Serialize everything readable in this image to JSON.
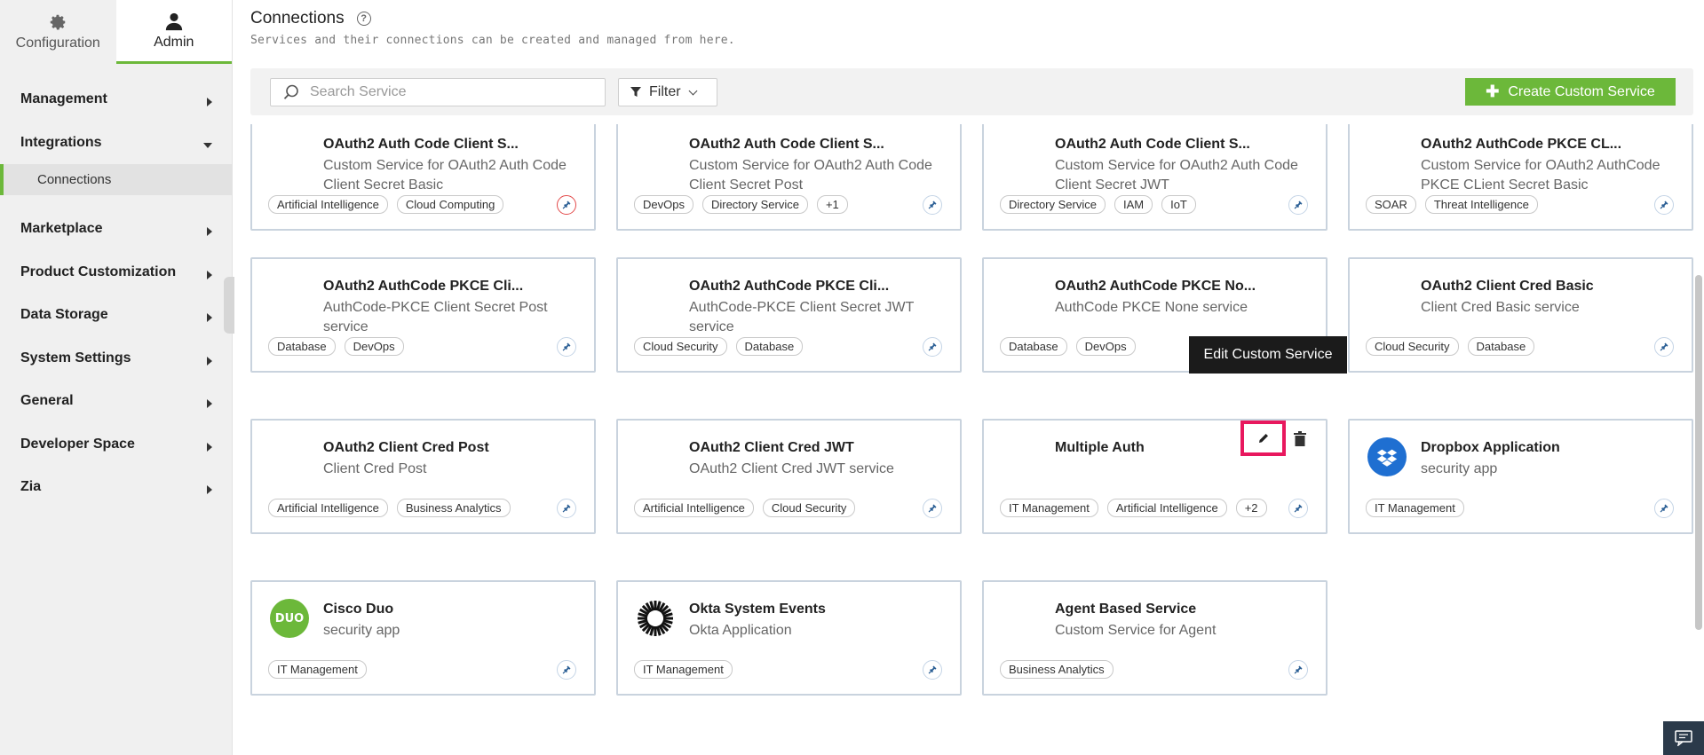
{
  "sidebar": {
    "tabs": [
      {
        "label": "Configuration",
        "icon": "gear-icon"
      },
      {
        "label": "Admin",
        "icon": "user-icon"
      }
    ],
    "items": [
      {
        "label": "Management"
      },
      {
        "label": "Integrations",
        "expanded": true,
        "sub": "Connections"
      },
      {
        "label": "Marketplace"
      },
      {
        "label": "Product Customization"
      },
      {
        "label": "Data Storage"
      },
      {
        "label": "System Settings"
      },
      {
        "label": "General"
      },
      {
        "label": "Developer Space"
      },
      {
        "label": "Zia"
      }
    ]
  },
  "header": {
    "title": "Connections",
    "subtitle": "Services and their connections can be created and managed from here."
  },
  "toolbar": {
    "search_placeholder": "Search Service",
    "filter_label": "Filter",
    "create_label": "Create Custom Service"
  },
  "colors": {
    "accent": "#6cb83a",
    "highlight": "#e8185e",
    "tooltip_bg": "#1b1b1b"
  },
  "cards": [
    {
      "title": "OAuth2 Auth Code Client S...",
      "desc": "Custom Service for OAuth2 Auth Code Client Secret Basic",
      "tags": [
        "Artificial Intelligence",
        "Cloud Computing"
      ],
      "conn_alert": true
    },
    {
      "title": "OAuth2 Auth Code Client S...",
      "desc": "Custom Service for OAuth2 Auth Code Client Secret Post",
      "tags": [
        "DevOps",
        "Directory Service",
        "+1"
      ]
    },
    {
      "title": "OAuth2 Auth Code Client S...",
      "desc": "Custom Service for OAuth2 Auth Code Client Secret JWT",
      "tags": [
        "Directory Service",
        "IAM",
        "IoT"
      ]
    },
    {
      "title": "OAuth2 AuthCode PKCE CL...",
      "desc": "Custom Service for OAuth2 AuthCode PKCE CLient Secret Basic",
      "tags": [
        "SOAR",
        "Threat Intelligence"
      ]
    },
    {
      "title": "OAuth2 AuthCode PKCE Cli...",
      "desc": "AuthCode-PKCE Client Secret Post service",
      "tags": [
        "Database",
        "DevOps"
      ]
    },
    {
      "title": "OAuth2 AuthCode PKCE Cli...",
      "desc": "AuthCode-PKCE Client Secret JWT service",
      "tags": [
        "Cloud Security",
        "Database"
      ]
    },
    {
      "title": "OAuth2 AuthCode PKCE No...",
      "desc": "AuthCode PKCE None service",
      "tags": [
        "Database",
        "DevOps"
      ]
    },
    {
      "title": "OAuth2 Client Cred Basic",
      "desc": "Client Cred Basic service",
      "tags": [
        "Cloud Security",
        "Database"
      ]
    },
    {
      "title": "OAuth2 Client Cred Post",
      "desc": "Client Cred Post",
      "tags": [
        "Artificial Intelligence",
        "Business Analytics"
      ]
    },
    {
      "title": "OAuth2 Client Cred JWT",
      "desc": "OAuth2 Client Cred JWT service",
      "tags": [
        "Artificial Intelligence",
        "Cloud Security"
      ]
    },
    {
      "title": "Multiple Auth",
      "desc": "",
      "tags": [
        "IT Management",
        "Artificial Intelligence",
        "+2"
      ],
      "hovered": true
    },
    {
      "title": "Dropbox Application",
      "desc": "security app",
      "tags": [
        "IT Management"
      ],
      "logo": "dropbox-logo"
    },
    {
      "title": "Cisco Duo",
      "desc": "security app",
      "tags": [
        "IT Management"
      ],
      "logo": "duo-logo"
    },
    {
      "title": "Okta System Events",
      "desc": "Okta Application",
      "tags": [
        "IT Management"
      ],
      "logo": "okta-logo"
    },
    {
      "title": "Agent Based Service",
      "desc": "Custom Service for Agent",
      "tags": [
        "Business Analytics"
      ]
    }
  ],
  "tooltip": {
    "text": "Edit Custom Service"
  },
  "duo_logo_text": "DUO"
}
